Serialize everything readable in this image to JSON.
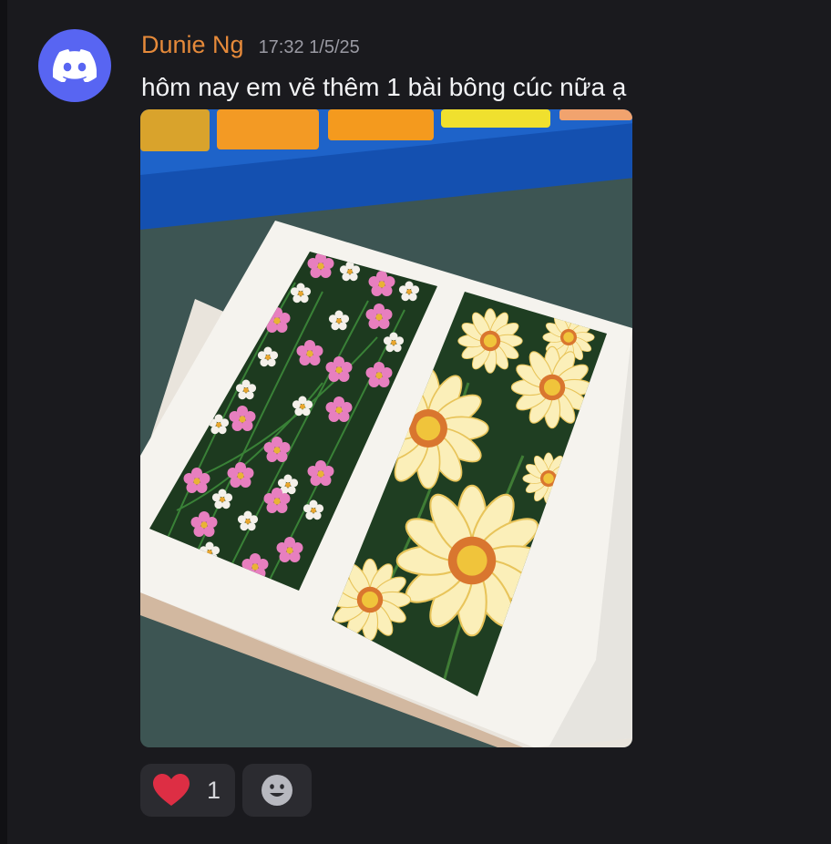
{
  "message": {
    "author": "Dunie Ng",
    "timestamp": "17:32 1/5/25",
    "text": "hôm nay em vẽ thêm 1 bài bông cúc nữa ạ",
    "author_color": "#e68a3a",
    "avatar": {
      "icon": "discord-logo-icon",
      "color": "#5865f2"
    },
    "attachment": {
      "alt": "painting of pink cosmos and white daisies on a sketchbook page"
    }
  },
  "reactions": [
    {
      "emoji": "heart-icon",
      "count": "1",
      "color": "#dd2e44"
    },
    {
      "emoji": "add-reaction-icon"
    }
  ]
}
